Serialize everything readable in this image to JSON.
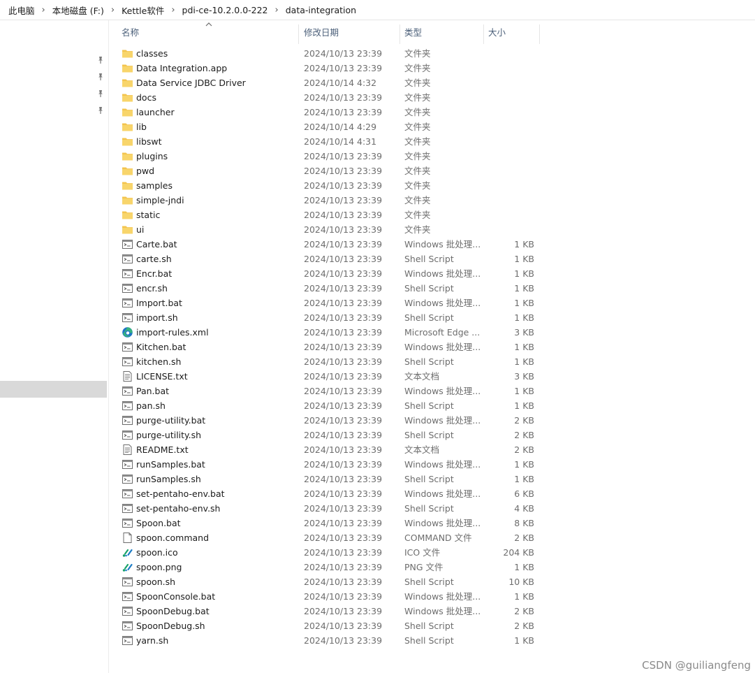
{
  "breadcrumb": [
    "此电脑",
    "本地磁盘 (F:)",
    "Kettle软件",
    "pdi-ce-10.2.0.0-222",
    "data-integration"
  ],
  "columns": {
    "name": "名称",
    "date": "修改日期",
    "type": "类型",
    "size": "大小"
  },
  "files": [
    {
      "name": "classes",
      "date": "2024/10/13 23:39",
      "type": "文件夹",
      "size": "",
      "icon": "folder-icon"
    },
    {
      "name": "Data Integration.app",
      "date": "2024/10/13 23:39",
      "type": "文件夹",
      "size": "",
      "icon": "folder-icon"
    },
    {
      "name": "Data Service JDBC Driver",
      "date": "2024/10/14 4:32",
      "type": "文件夹",
      "size": "",
      "icon": "folder-icon"
    },
    {
      "name": "docs",
      "date": "2024/10/13 23:39",
      "type": "文件夹",
      "size": "",
      "icon": "folder-icon"
    },
    {
      "name": "launcher",
      "date": "2024/10/13 23:39",
      "type": "文件夹",
      "size": "",
      "icon": "folder-icon"
    },
    {
      "name": "lib",
      "date": "2024/10/14 4:29",
      "type": "文件夹",
      "size": "",
      "icon": "folder-icon"
    },
    {
      "name": "libswt",
      "date": "2024/10/14 4:31",
      "type": "文件夹",
      "size": "",
      "icon": "folder-icon"
    },
    {
      "name": "plugins",
      "date": "2024/10/13 23:39",
      "type": "文件夹",
      "size": "",
      "icon": "folder-icon"
    },
    {
      "name": "pwd",
      "date": "2024/10/13 23:39",
      "type": "文件夹",
      "size": "",
      "icon": "folder-icon"
    },
    {
      "name": "samples",
      "date": "2024/10/13 23:39",
      "type": "文件夹",
      "size": "",
      "icon": "folder-icon"
    },
    {
      "name": "simple-jndi",
      "date": "2024/10/13 23:39",
      "type": "文件夹",
      "size": "",
      "icon": "folder-icon"
    },
    {
      "name": "static",
      "date": "2024/10/13 23:39",
      "type": "文件夹",
      "size": "",
      "icon": "folder-icon"
    },
    {
      "name": "ui",
      "date": "2024/10/13 23:39",
      "type": "文件夹",
      "size": "",
      "icon": "folder-icon"
    },
    {
      "name": "Carte.bat",
      "date": "2024/10/13 23:39",
      "type": "Windows 批处理...",
      "size": "1 KB",
      "icon": "batch-file-icon"
    },
    {
      "name": "carte.sh",
      "date": "2024/10/13 23:39",
      "type": "Shell Script",
      "size": "1 KB",
      "icon": "batch-file-icon"
    },
    {
      "name": "Encr.bat",
      "date": "2024/10/13 23:39",
      "type": "Windows 批处理...",
      "size": "1 KB",
      "icon": "batch-file-icon"
    },
    {
      "name": "encr.sh",
      "date": "2024/10/13 23:39",
      "type": "Shell Script",
      "size": "1 KB",
      "icon": "batch-file-icon"
    },
    {
      "name": "Import.bat",
      "date": "2024/10/13 23:39",
      "type": "Windows 批处理...",
      "size": "1 KB",
      "icon": "batch-file-icon"
    },
    {
      "name": "import.sh",
      "date": "2024/10/13 23:39",
      "type": "Shell Script",
      "size": "1 KB",
      "icon": "batch-file-icon"
    },
    {
      "name": "import-rules.xml",
      "date": "2024/10/13 23:39",
      "type": "Microsoft Edge ...",
      "size": "3 KB",
      "icon": "edge-icon"
    },
    {
      "name": "Kitchen.bat",
      "date": "2024/10/13 23:39",
      "type": "Windows 批处理...",
      "size": "1 KB",
      "icon": "batch-file-icon"
    },
    {
      "name": "kitchen.sh",
      "date": "2024/10/13 23:39",
      "type": "Shell Script",
      "size": "1 KB",
      "icon": "batch-file-icon"
    },
    {
      "name": "LICENSE.txt",
      "date": "2024/10/13 23:39",
      "type": "文本文档",
      "size": "3 KB",
      "icon": "text-file-icon"
    },
    {
      "name": "Pan.bat",
      "date": "2024/10/13 23:39",
      "type": "Windows 批处理...",
      "size": "1 KB",
      "icon": "batch-file-icon"
    },
    {
      "name": "pan.sh",
      "date": "2024/10/13 23:39",
      "type": "Shell Script",
      "size": "1 KB",
      "icon": "batch-file-icon"
    },
    {
      "name": "purge-utility.bat",
      "date": "2024/10/13 23:39",
      "type": "Windows 批处理...",
      "size": "2 KB",
      "icon": "batch-file-icon"
    },
    {
      "name": "purge-utility.sh",
      "date": "2024/10/13 23:39",
      "type": "Shell Script",
      "size": "2 KB",
      "icon": "batch-file-icon"
    },
    {
      "name": "README.txt",
      "date": "2024/10/13 23:39",
      "type": "文本文档",
      "size": "2 KB",
      "icon": "text-file-icon"
    },
    {
      "name": "runSamples.bat",
      "date": "2024/10/13 23:39",
      "type": "Windows 批处理...",
      "size": "1 KB",
      "icon": "batch-file-icon"
    },
    {
      "name": "runSamples.sh",
      "date": "2024/10/13 23:39",
      "type": "Shell Script",
      "size": "1 KB",
      "icon": "batch-file-icon"
    },
    {
      "name": "set-pentaho-env.bat",
      "date": "2024/10/13 23:39",
      "type": "Windows 批处理...",
      "size": "6 KB",
      "icon": "batch-file-icon"
    },
    {
      "name": "set-pentaho-env.sh",
      "date": "2024/10/13 23:39",
      "type": "Shell Script",
      "size": "4 KB",
      "icon": "batch-file-icon"
    },
    {
      "name": "Spoon.bat",
      "date": "2024/10/13 23:39",
      "type": "Windows 批处理...",
      "size": "8 KB",
      "icon": "batch-file-icon"
    },
    {
      "name": "spoon.command",
      "date": "2024/10/13 23:39",
      "type": "COMMAND 文件",
      "size": "2 KB",
      "icon": "blank-file-icon"
    },
    {
      "name": "spoon.ico",
      "date": "2024/10/13 23:39",
      "type": "ICO 文件",
      "size": "204 KB",
      "icon": "spoon-logo-icon"
    },
    {
      "name": "spoon.png",
      "date": "2024/10/13 23:39",
      "type": "PNG 文件",
      "size": "1 KB",
      "icon": "spoon-logo-icon"
    },
    {
      "name": "spoon.sh",
      "date": "2024/10/13 23:39",
      "type": "Shell Script",
      "size": "10 KB",
      "icon": "batch-file-icon"
    },
    {
      "name": "SpoonConsole.bat",
      "date": "2024/10/13 23:39",
      "type": "Windows 批处理...",
      "size": "1 KB",
      "icon": "batch-file-icon"
    },
    {
      "name": "SpoonDebug.bat",
      "date": "2024/10/13 23:39",
      "type": "Windows 批处理...",
      "size": "2 KB",
      "icon": "batch-file-icon"
    },
    {
      "name": "SpoonDebug.sh",
      "date": "2024/10/13 23:39",
      "type": "Shell Script",
      "size": "2 KB",
      "icon": "batch-file-icon"
    },
    {
      "name": "yarn.sh",
      "date": "2024/10/13 23:39",
      "type": "Shell Script",
      "size": "1 KB",
      "icon": "batch-file-icon"
    }
  ],
  "watermark": "CSDN @guiliangfeng",
  "colors": {
    "folder": "#f3c44e",
    "header_text": "#4c607a",
    "secondary_text": "#6d6d6d",
    "nav_selection": "#d9d9d9",
    "edge_blue": "#1f73c7",
    "edge_green": "#36b37e",
    "spoon_green": "#1aa36a",
    "spoon_blue": "#1d7cc6"
  }
}
